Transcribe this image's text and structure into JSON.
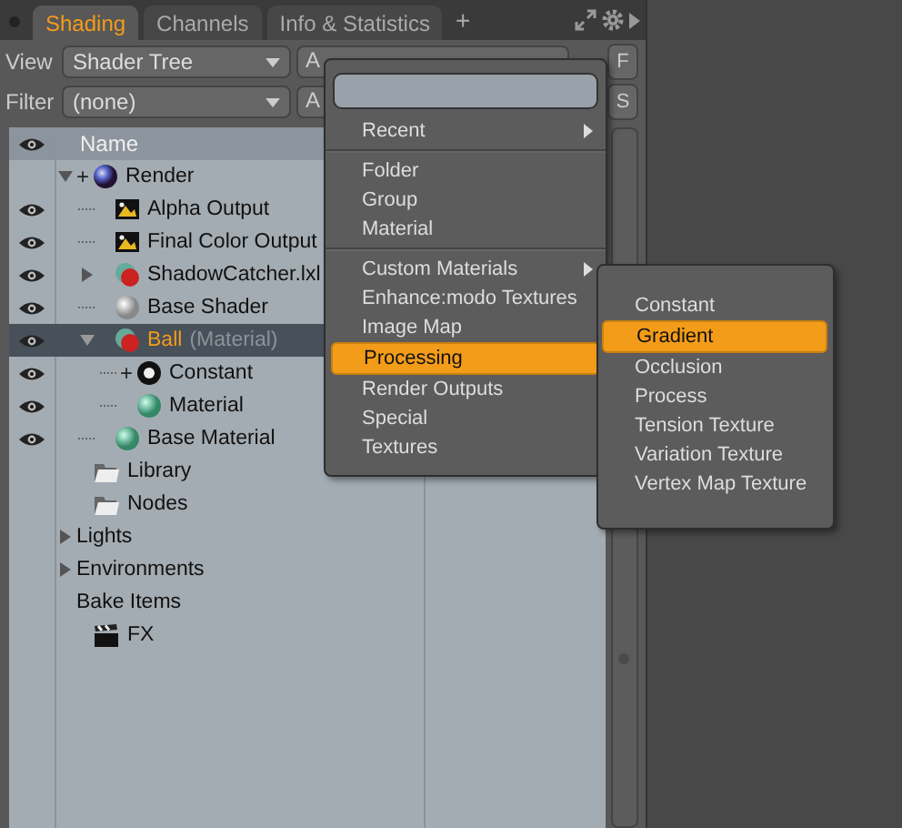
{
  "tabs": [
    {
      "label": "Shading",
      "selected": true
    },
    {
      "label": "Channels",
      "selected": false
    },
    {
      "label": "Info & Statistics",
      "selected": false
    }
  ],
  "add_tab": "+",
  "toolbar_rows": [
    {
      "label": "View",
      "value": "Shader Tree",
      "button": "A",
      "side_button": "F"
    },
    {
      "label": "Filter",
      "value": "(none)",
      "button": "A",
      "side_button": "S"
    }
  ],
  "tree": {
    "column": "Name",
    "items": [
      {
        "label": "Render",
        "kind": "render",
        "eye": false,
        "expanded": true,
        "add_mark": "+",
        "selected": false,
        "children": [
          {
            "label": "Alpha Output",
            "kind": "output",
            "eye": true,
            "selected": false
          },
          {
            "label": "Final Color Output",
            "kind": "output",
            "eye": true,
            "selected": false
          },
          {
            "label": "ShadowCatcher.lxl",
            "kind": "mask",
            "eye": true,
            "expanded": false,
            "selected": false
          },
          {
            "label": "Base Shader",
            "kind": "shader",
            "eye": true,
            "selected": false
          },
          {
            "label": "Ball",
            "type_label": "(Material)",
            "kind": "mask",
            "eye": true,
            "expanded": true,
            "selected": true,
            "children": [
              {
                "label": "Constant",
                "kind": "constant",
                "eye": true,
                "add_mark": "+",
                "selected": false
              },
              {
                "label": "Material",
                "kind": "material",
                "eye": true,
                "selected": false
              }
            ]
          },
          {
            "label": "Base Material",
            "kind": "material",
            "eye": true,
            "selected": false
          }
        ]
      },
      {
        "label": "Library",
        "kind": "folder",
        "eye": false,
        "selected": false
      },
      {
        "label": "Nodes",
        "kind": "folder",
        "eye": false,
        "selected": false
      },
      {
        "label": "Lights",
        "kind": "plain",
        "eye": false,
        "expanded": false,
        "selected": false
      },
      {
        "label": "Environments",
        "kind": "plain",
        "eye": false,
        "expanded": false,
        "selected": false
      },
      {
        "label": "Bake Items",
        "kind": "plain",
        "eye": false,
        "selected": false
      },
      {
        "label": "FX",
        "kind": "fx",
        "eye": false,
        "selected": false
      }
    ]
  },
  "menu": {
    "items": [
      {
        "kind": "submenu",
        "label": "Recent",
        "selected": false
      },
      {
        "kind": "separator"
      },
      {
        "kind": "item",
        "label": "Folder",
        "selected": false
      },
      {
        "kind": "item",
        "label": "Group",
        "selected": false
      },
      {
        "kind": "item",
        "label": "Material",
        "selected": false
      },
      {
        "kind": "separator"
      },
      {
        "kind": "submenu",
        "label": "Custom Materials",
        "selected": false
      },
      {
        "kind": "item",
        "label": "Enhance:modo Textures",
        "selected": false
      },
      {
        "kind": "item",
        "label": "Image Map",
        "selected": false
      },
      {
        "kind": "item",
        "label": "Processing",
        "selected": true
      },
      {
        "kind": "item",
        "label": "Render Outputs",
        "selected": false
      },
      {
        "kind": "item",
        "label": "Special",
        "selected": false
      },
      {
        "kind": "item",
        "label": "Textures",
        "selected": false
      }
    ]
  },
  "submenu": {
    "items": [
      {
        "label": "Constant",
        "selected": false
      },
      {
        "label": "Gradient",
        "selected": true
      },
      {
        "label": "Occlusion",
        "selected": false
      },
      {
        "label": "Process",
        "selected": false
      },
      {
        "label": "Tension Texture",
        "selected": false
      },
      {
        "label": "Variation Texture",
        "selected": false
      },
      {
        "label": "Vertex Map Texture",
        "selected": false
      }
    ]
  }
}
